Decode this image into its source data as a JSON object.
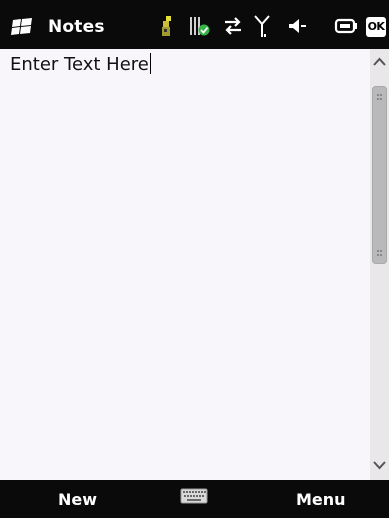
{
  "titlebar": {
    "app_title": "Notes",
    "start_icon": "windows-flag-icon",
    "tray_icons": [
      "connectivity-icon",
      "battery-status-icon",
      "data-sync-icon",
      "signal-icon",
      "volume-icon",
      "battery-icon"
    ],
    "ok_label": "OK"
  },
  "note": {
    "text": "Enter Text Here"
  },
  "scrollbar": {
    "up_icon": "chevron-up-icon",
    "down_icon": "chevron-down-icon"
  },
  "softkeys": {
    "left_label": "New",
    "right_label": "Menu",
    "center_icon": "keyboard-icon"
  },
  "colors": {
    "bar_background": "#0a0a0a",
    "note_background": "#f8f6fa",
    "scroll_thumb": "#b9b9bb"
  }
}
